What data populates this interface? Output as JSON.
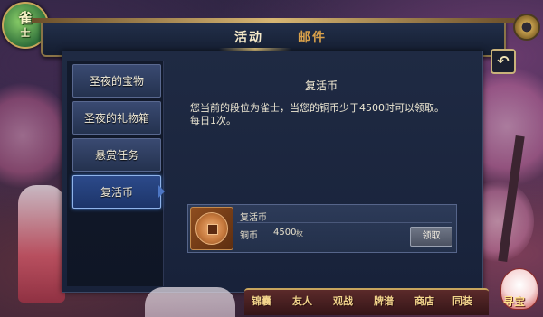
{
  "logo": {
    "line1": "雀",
    "line2": "士"
  },
  "tabs": {
    "activity": "活动",
    "mail": "邮件"
  },
  "sidebar": {
    "items": [
      {
        "label": "圣夜的宝物"
      },
      {
        "label": "圣夜的礼物箱"
      },
      {
        "label": "悬赏任务"
      },
      {
        "label": "复活币"
      }
    ],
    "active_index": 3
  },
  "content": {
    "title": "复活币",
    "description": "您当前的段位为雀士，当您的铜币少于4500时可以领取。每日1次。"
  },
  "reward": {
    "name": "复活币",
    "label": "铜币",
    "amount": "4500",
    "unit": "枚",
    "claim_button": "领取"
  },
  "bottom_nav": {
    "items": [
      "锦囊",
      "友人",
      "观战",
      "牌谱",
      "商店",
      "同装"
    ],
    "mascot_text": "寻宝"
  },
  "colors": {
    "panel_bg": "#1f2a43",
    "active_item": "#2c4a8a",
    "tab_active": "#f5e9c8",
    "tab_inactive": "#d8a04a",
    "frame_gold": "#c8a55d"
  },
  "icons": {
    "settings": "gear-icon",
    "back": "back-arrow-icon",
    "coin": "copper-coin-icon"
  }
}
